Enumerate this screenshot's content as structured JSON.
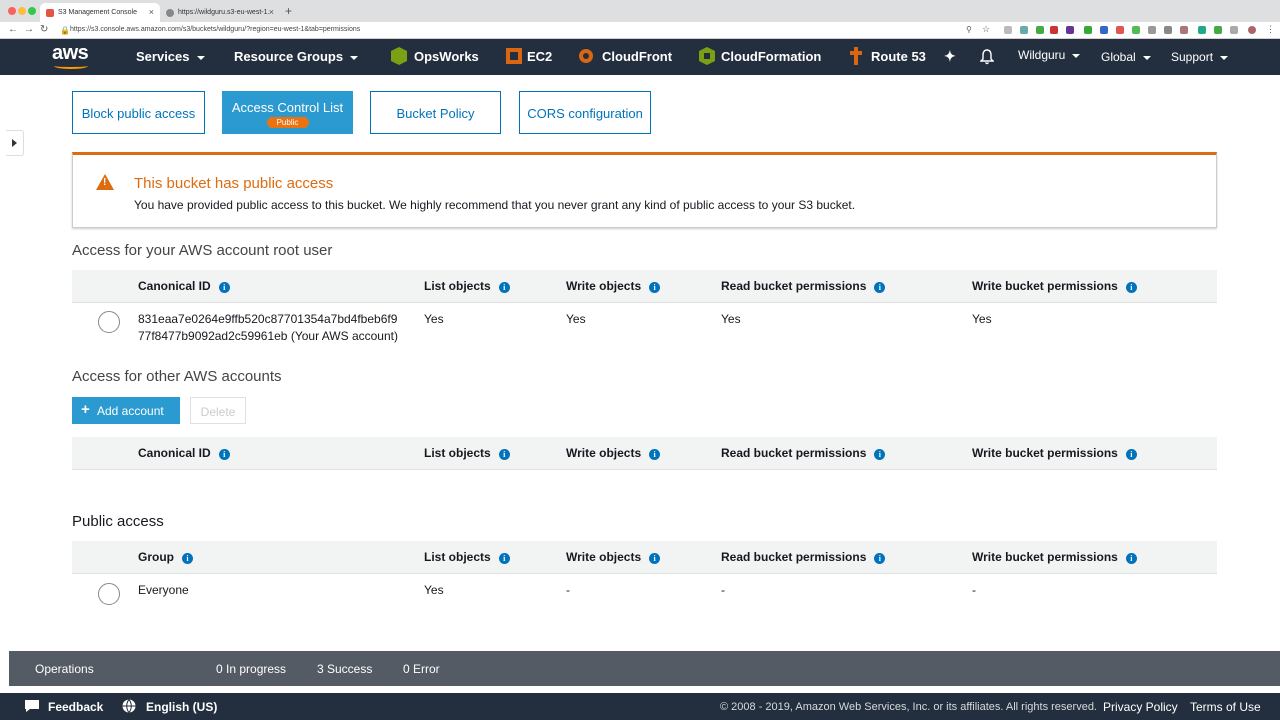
{
  "browser": {
    "tabs": [
      {
        "title": "S3 Management Console",
        "active": true
      },
      {
        "title": "https://wildguru.s3-eu-west-1.",
        "active": false
      }
    ],
    "new_tab": "+",
    "url": "https://s3.console.aws.amazon.com/s3/buckets/wildguru/?region=eu-west-1&tab=permissions"
  },
  "awsnav": {
    "logo": "aws",
    "services": "Services",
    "resource_groups": "Resource Groups",
    "shortcuts": [
      "OpsWorks",
      "EC2",
      "CloudFront",
      "CloudFormation",
      "Route 53"
    ],
    "account": "Wildguru",
    "region": "Global",
    "support": "Support"
  },
  "permission_tabs": {
    "block": "Block public access",
    "acl": "Access Control List",
    "acl_badge": "Public",
    "policy": "Bucket Policy",
    "cors": "CORS configuration"
  },
  "alert": {
    "title": "This bucket has public access",
    "text": "You have provided public access to this bucket. We highly recommend that you never grant any kind of public access to your S3 bucket."
  },
  "root_section": {
    "title": "Access for your AWS account root user",
    "columns": [
      "Canonical ID",
      "List objects",
      "Write objects",
      "Read bucket permissions",
      "Write bucket permissions"
    ],
    "row": {
      "id_line1": "831eaa7e0264e9ffb520c87701354a7bd4fbeb6f9",
      "id_line2": "77f8477b9092ad2c59961eb (Your AWS account)",
      "list": "Yes",
      "write": "Yes",
      "read_perm": "Yes",
      "write_perm": "Yes"
    }
  },
  "other_section": {
    "title": "Access for other AWS accounts",
    "add_button": "Add account",
    "delete_button": "Delete",
    "columns": [
      "Canonical ID",
      "List objects",
      "Write objects",
      "Read bucket permissions",
      "Write bucket permissions"
    ]
  },
  "public_section": {
    "title": "Public access",
    "columns": [
      "Group",
      "List objects",
      "Write objects",
      "Read bucket permissions",
      "Write bucket permissions"
    ],
    "row": {
      "group": "Everyone",
      "list": "Yes",
      "write": "-",
      "read_perm": "-",
      "write_perm": "-"
    }
  },
  "operations": {
    "label": "Operations",
    "in_progress": "0 In progress",
    "success": "3 Success",
    "error": "0 Error"
  },
  "footer": {
    "feedback": "Feedback",
    "language": "English (US)",
    "copyright": "© 2008 - 2019, Amazon Web Services, Inc. or its affiliates. All rights reserved.",
    "privacy": "Privacy Policy",
    "terms": "Terms of Use"
  },
  "colors": {
    "nav_bg": "#232f3e",
    "accent": "#2a9ad1",
    "link": "#0073bb",
    "warning": "#dd6b10",
    "ops_bg": "#545b64"
  }
}
